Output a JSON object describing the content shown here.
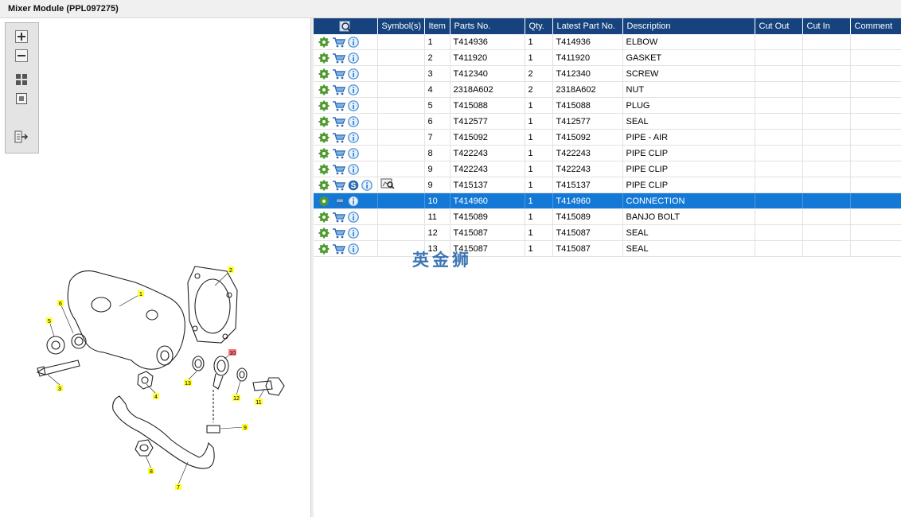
{
  "window": {
    "title": "Mixer Module (PPL097275)"
  },
  "toolbar": {
    "buttons": [
      {
        "name": "zoom-in-icon"
      },
      {
        "name": "zoom-out-icon"
      },
      {
        "name": "fit-all-icon"
      },
      {
        "name": "actual-size-icon"
      },
      {
        "name": "export-icon"
      }
    ]
  },
  "diagram": {
    "callouts": [
      "1",
      "2",
      "3",
      "5",
      "6",
      "4",
      "13",
      "10",
      "12",
      "11",
      "9",
      "8",
      "7"
    ],
    "highlighted_callout": "10"
  },
  "grid": {
    "columns": [
      "",
      "Symbol(s)",
      "Item",
      "Parts No.",
      "Qty.",
      "Latest Part No.",
      "Description",
      "Cut Out",
      "Cut In",
      "Comment"
    ],
    "rows": [
      {
        "item": "1",
        "part": "T414936",
        "qty": "1",
        "latest": "T414936",
        "desc": "ELBOW",
        "s_icon": false,
        "symbol": false,
        "selected": false
      },
      {
        "item": "2",
        "part": "T411920",
        "qty": "1",
        "latest": "T411920",
        "desc": "GASKET",
        "s_icon": false,
        "symbol": false,
        "selected": false
      },
      {
        "item": "3",
        "part": "T412340",
        "qty": "2",
        "latest": "T412340",
        "desc": "SCREW",
        "s_icon": false,
        "symbol": false,
        "selected": false
      },
      {
        "item": "4",
        "part": "2318A602",
        "qty": "2",
        "latest": "2318A602",
        "desc": "NUT",
        "s_icon": false,
        "symbol": false,
        "selected": false
      },
      {
        "item": "5",
        "part": "T415088",
        "qty": "1",
        "latest": "T415088",
        "desc": "PLUG",
        "s_icon": false,
        "symbol": false,
        "selected": false
      },
      {
        "item": "6",
        "part": "T412577",
        "qty": "1",
        "latest": "T412577",
        "desc": "SEAL",
        "s_icon": false,
        "symbol": false,
        "selected": false
      },
      {
        "item": "7",
        "part": "T415092",
        "qty": "1",
        "latest": "T415092",
        "desc": "PIPE - AIR",
        "s_icon": false,
        "symbol": false,
        "selected": false
      },
      {
        "item": "8",
        "part": "T422243",
        "qty": "1",
        "latest": "T422243",
        "desc": "PIPE CLIP",
        "s_icon": false,
        "symbol": false,
        "selected": false
      },
      {
        "item": "9",
        "part": "T422243",
        "qty": "1",
        "latest": "T422243",
        "desc": "PIPE CLIP",
        "s_icon": false,
        "symbol": false,
        "selected": false
      },
      {
        "item": "9",
        "part": "T415137",
        "qty": "1",
        "latest": "T415137",
        "desc": "PIPE CLIP",
        "s_icon": true,
        "symbol": true,
        "selected": false
      },
      {
        "item": "10",
        "part": "T414960",
        "qty": "1",
        "latest": "T414960",
        "desc": "CONNECTION",
        "s_icon": false,
        "symbol": false,
        "selected": true
      },
      {
        "item": "11",
        "part": "T415089",
        "qty": "1",
        "latest": "T415089",
        "desc": "BANJO BOLT",
        "s_icon": false,
        "symbol": false,
        "selected": false
      },
      {
        "item": "12",
        "part": "T415087",
        "qty": "1",
        "latest": "T415087",
        "desc": "SEAL",
        "s_icon": false,
        "symbol": false,
        "selected": false
      },
      {
        "item": "13",
        "part": "T415087",
        "qty": "1",
        "latest": "T415087",
        "desc": "SEAL",
        "s_icon": false,
        "symbol": false,
        "selected": false
      }
    ]
  },
  "watermark": {
    "text": "英金狮"
  },
  "colors": {
    "header": "#16437e",
    "selected": "#1479d6",
    "gear": "#4f9a2f",
    "cart": "#2a6cb3",
    "info": "#3a86d4"
  }
}
